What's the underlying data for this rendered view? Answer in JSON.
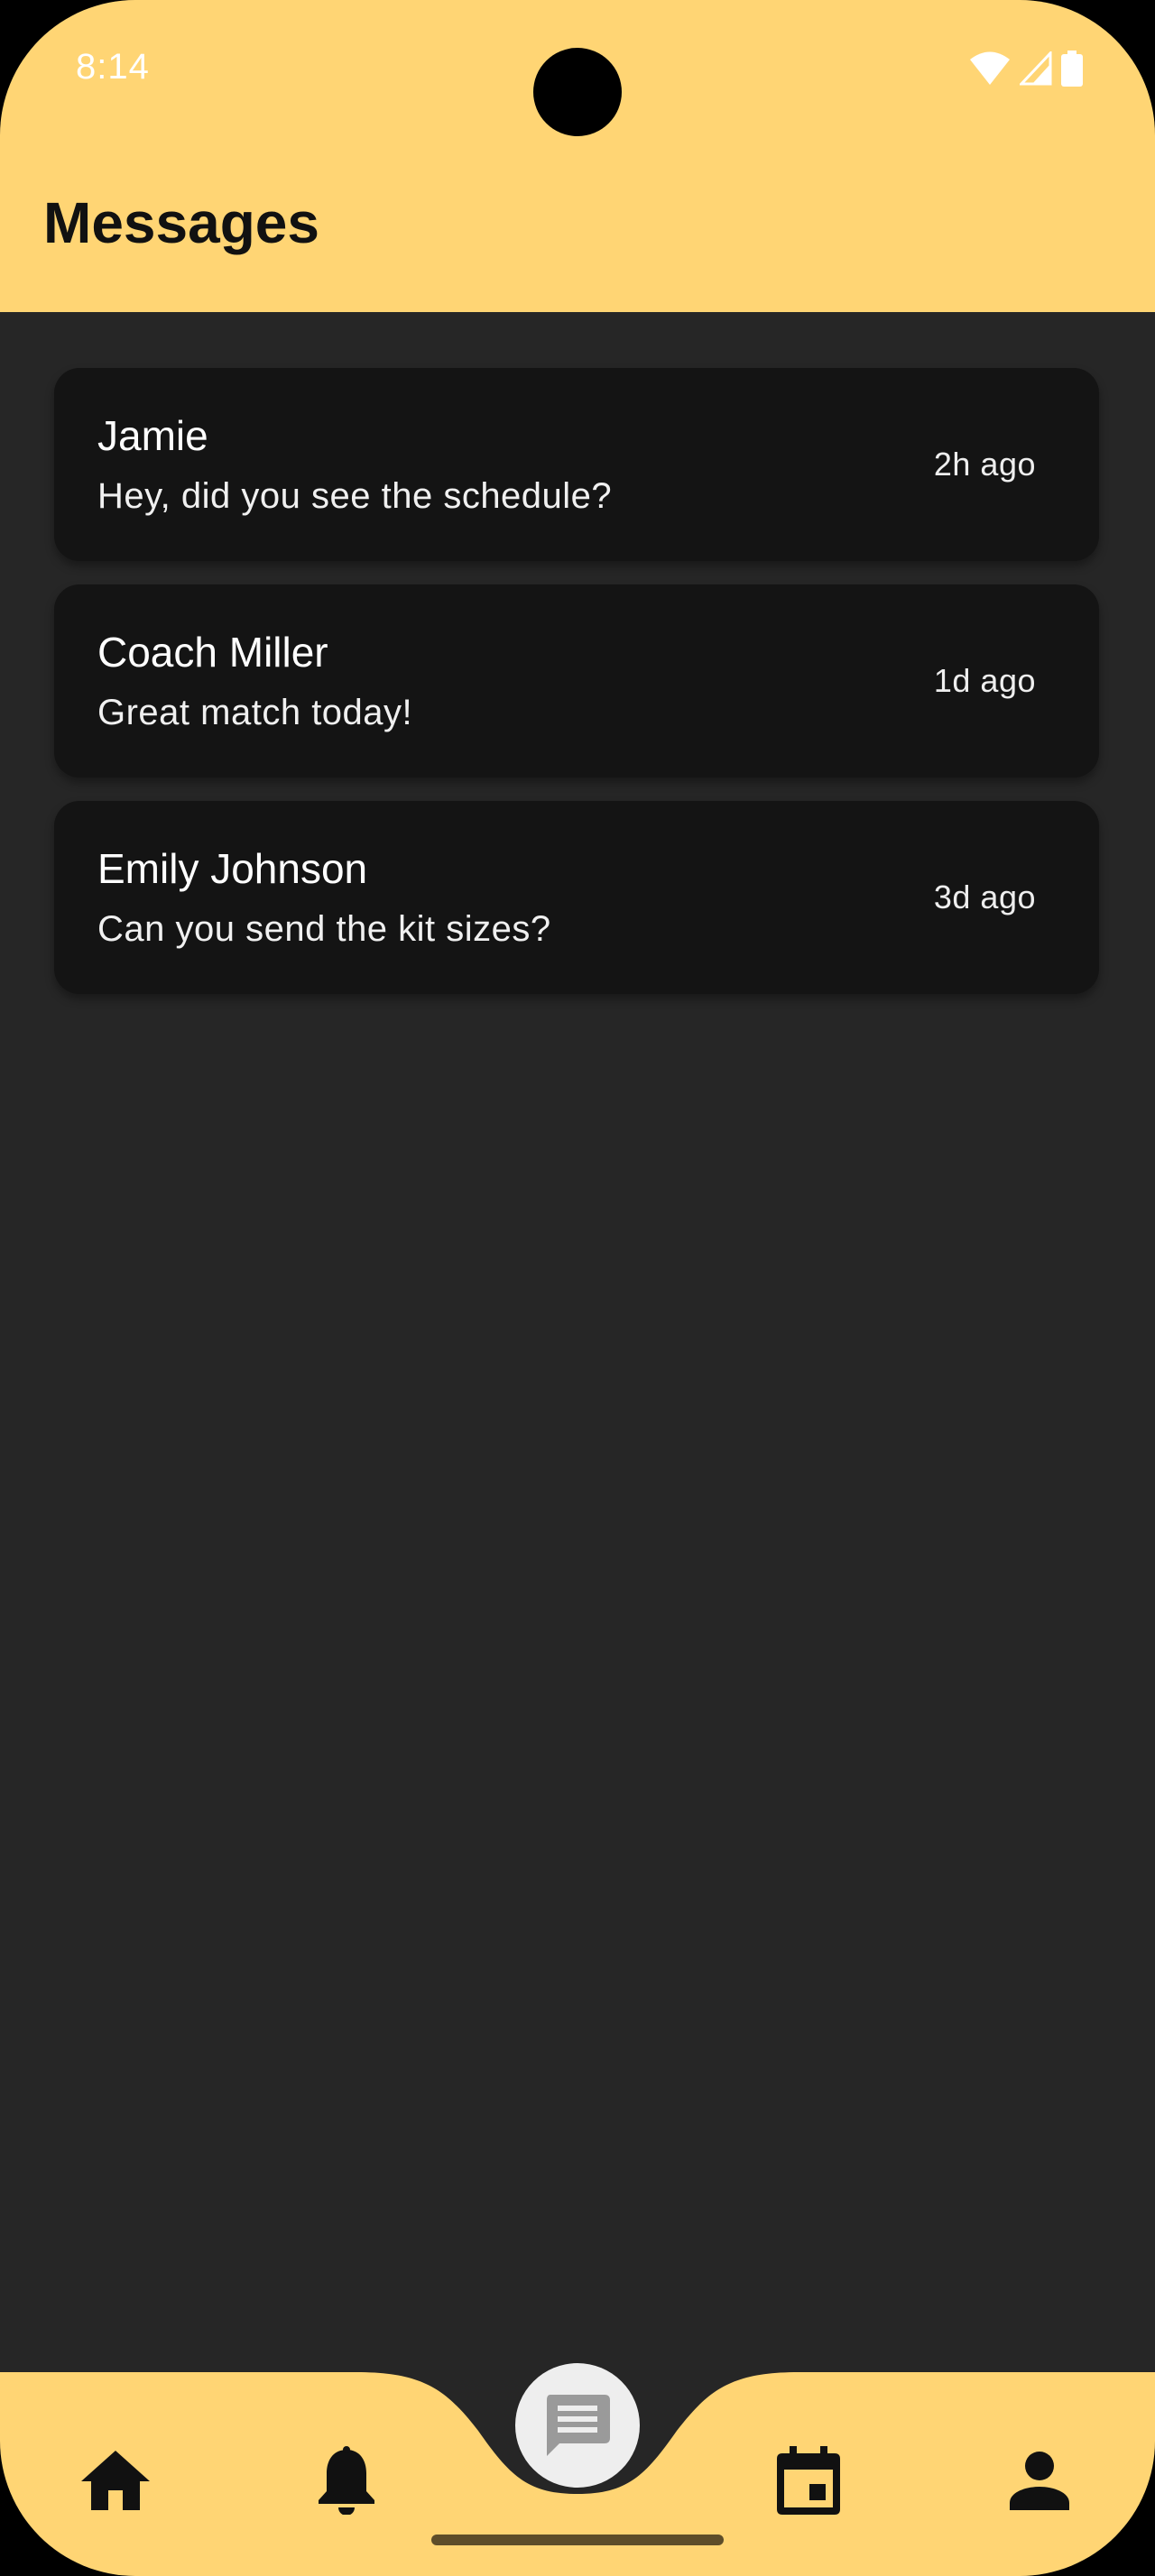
{
  "status_bar": {
    "time": "8:14",
    "icons": [
      "wifi-icon",
      "cellular-signal-icon",
      "battery-icon"
    ]
  },
  "header": {
    "title": "Messages"
  },
  "messages": [
    {
      "name": "Jamie",
      "preview": "Hey, did you see the schedule?",
      "time": "2h ago"
    },
    {
      "name": "Coach Miller",
      "preview": "Great match today!",
      "time": "1d ago"
    },
    {
      "name": "Emily Johnson",
      "preview": "Can you send the kit sizes?",
      "time": "3d ago"
    }
  ],
  "bottom_nav": {
    "items": [
      "home-icon",
      "bell-icon",
      "chat-icon",
      "calendar-icon",
      "person-icon"
    ],
    "active": "chat-icon"
  },
  "colors": {
    "accent": "#FFD574",
    "background": "#262626",
    "card": "#141414",
    "fab": "#EEEEEE"
  }
}
